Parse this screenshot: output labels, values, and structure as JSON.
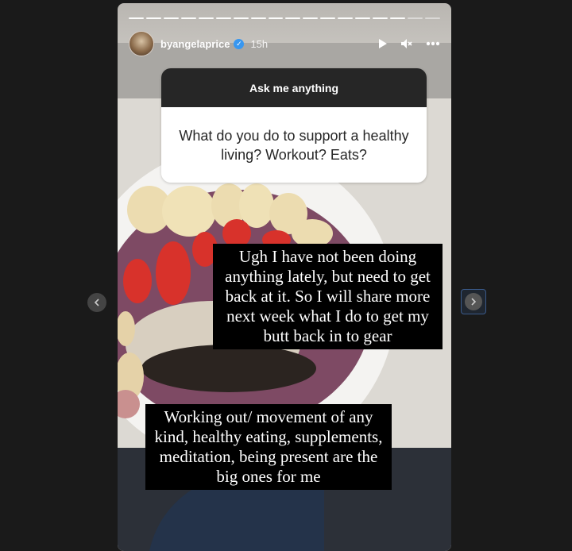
{
  "story": {
    "username": "byangelaprice",
    "time": "15h",
    "segments_total": 18,
    "segments_viewed": 16
  },
  "question_sticker": {
    "header": "Ask me anything",
    "question": "What do you do to support a healthy living? Workout? Eats?"
  },
  "captions": [
    "Ugh I have not been doing anything lately, but need to get back at it. So I will share more next week what I do to get my butt back in to gear",
    "Working out/ movement of any kind, healthy eating, supplements, meditation, being present are the big ones for me"
  ],
  "icons": {
    "play": "play-icon",
    "mute": "mute-icon",
    "more": "more-options-icon",
    "verified": "verified-badge-icon",
    "prev": "chevron-left-icon",
    "next": "chevron-right-icon"
  }
}
